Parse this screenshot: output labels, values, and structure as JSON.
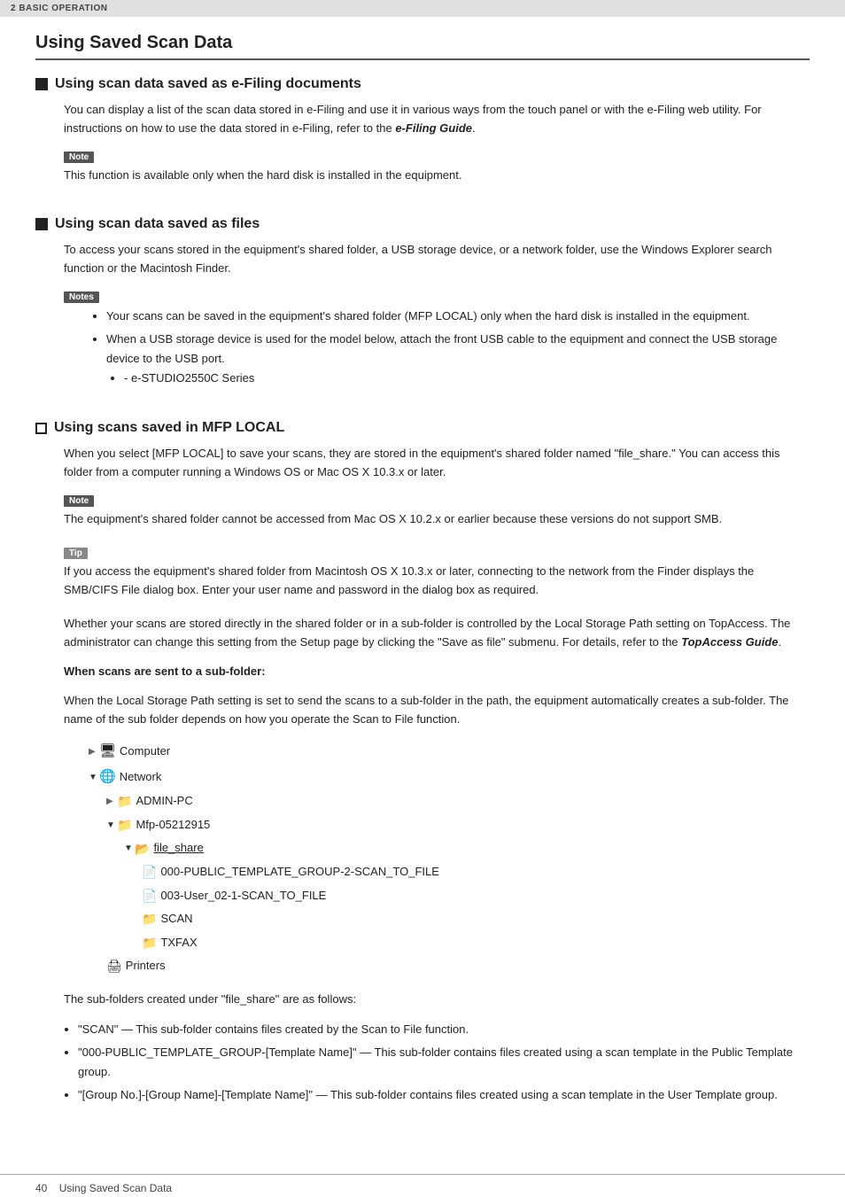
{
  "topbar": {
    "label": "2 BASIC OPERATION"
  },
  "page_title": "Using Saved Scan Data",
  "section1": {
    "title": "Using scan data saved as e-Filing documents",
    "body": "You can display a list of the scan data stored in e-Filing and use it in various ways from the touch panel or with the e-Filing web utility. For instructions on how to use the data stored in e-Filing, refer to the ",
    "bold_italic": "e-Filing Guide",
    "body_end": ".",
    "note_label": "Note",
    "note_text": "This function is available only when the hard disk is installed in the equipment."
  },
  "section2": {
    "title": "Using scan data saved as files",
    "body": "To access your scans stored in the equipment's shared folder, a USB storage device, or a network folder, use the Windows Explorer search function or the Macintosh Finder.",
    "notes_label": "Notes",
    "bullets": [
      "Your scans can be saved in the equipment's shared folder (MFP LOCAL) only when the hard disk is installed in the equipment.",
      "When a USB storage device is used for the model below, attach the front USB cable to the equipment and connect the USB storage device to the USB port."
    ],
    "sub_bullet": "e-STUDIO2550C Series"
  },
  "section3": {
    "title": "Using scans saved in MFP LOCAL",
    "body1": "When you select [MFP LOCAL] to save your scans, they are stored in the equipment's shared folder named \"file_share.\" You can access this folder from a computer running a Windows OS or Mac OS X 10.3.x or later.",
    "note_label": "Note",
    "note_text": "The equipment's shared folder cannot be accessed from Mac OS X 10.2.x or earlier because these versions do not support SMB.",
    "tip_label": "Tip",
    "tip_text": "If you access the equipment's shared folder from Macintosh OS X 10.3.x or later, connecting to the network from the Finder displays the SMB/CIFS File dialog box. Enter your user name and password in the dialog box as required.",
    "body2": "Whether your scans are stored directly in the shared folder or in a sub-folder is controlled by the Local Storage Path setting on TopAccess. The administrator can change this setting from the Setup page by clicking the \"Save as file\" submenu. For details, refer to the ",
    "bold_italic2": "TopAccess Guide",
    "body2_end": ".",
    "subsection_title": "When scans are sent to a sub-folder:",
    "subsection_body": "When the Local Storage Path setting is set to send the scans to a sub-folder in the path, the equipment automatically creates a sub-folder. The name of the sub folder depends on how you operate the Scan to File function.",
    "tree": {
      "computer": "Computer",
      "network": "Network",
      "admin_pc": "ADMIN-PC",
      "mfp": "Mfp-05212915",
      "file_share": "file_share",
      "folder1": "000-PUBLIC_TEMPLATE_GROUP-2-SCAN_TO_FILE",
      "folder2": "003-User_02-1-SCAN_TO_FILE",
      "folder3": "SCAN",
      "folder4": "TXFAX",
      "printers": "Printers"
    },
    "subfolder_intro": "The sub-folders created under \"file_share\" are as follows:",
    "subfolder_bullets": [
      "\"SCAN\" — This sub-folder contains files created by the Scan to File function.",
      "\"000-PUBLIC_TEMPLATE_GROUP-[Template Name]\" — This sub-folder contains files created using a scan template in the Public Template group.",
      "\"[Group No.]-[Group Name]-[Template Name]\" — This sub-folder contains files created using a scan template in the User Template group."
    ]
  },
  "footer": {
    "page_number": "40",
    "label": "Using Saved Scan Data"
  }
}
